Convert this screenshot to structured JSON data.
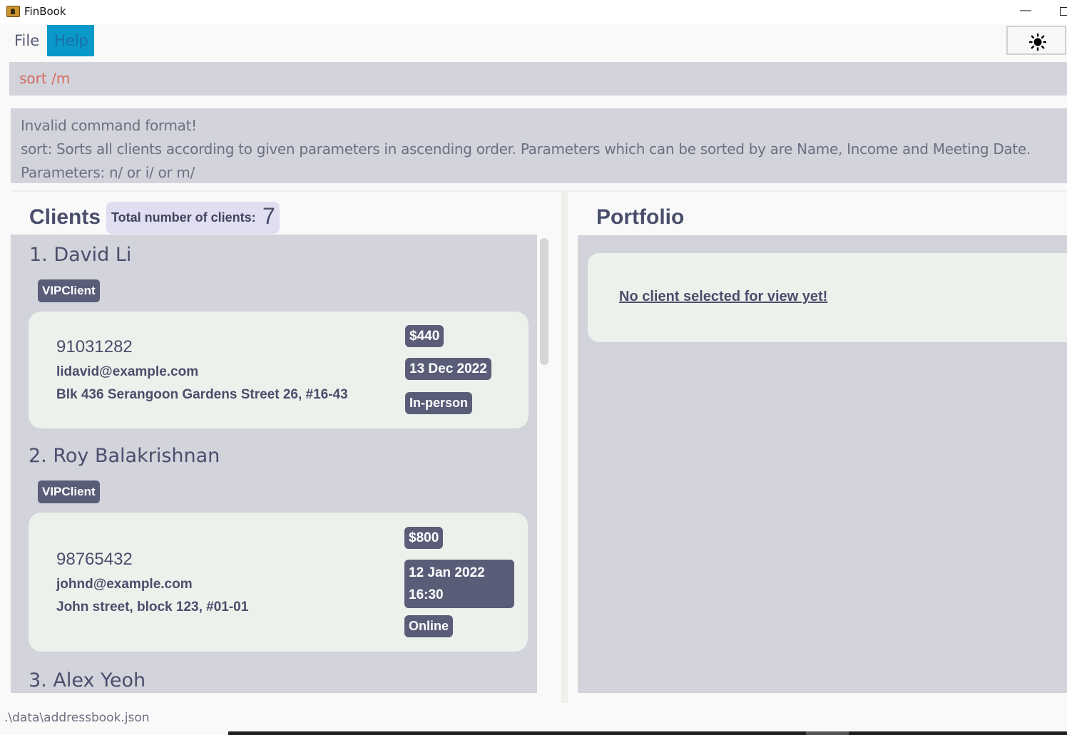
{
  "window": {
    "title": "FinBook"
  },
  "menu": {
    "file": "File",
    "help": "Help"
  },
  "command": {
    "value": "sort /m"
  },
  "result": {
    "lines": [
      "Invalid command format!",
      "sort: Sorts all clients according to given parameters in ascending order. Parameters which can be sorted by are Name, Income and Meeting Date.",
      "Parameters: n/ or i/ or m/"
    ]
  },
  "clients_panel": {
    "title": "Clients",
    "total_label": "Total number of clients:",
    "total_count": "7",
    "clients": [
      {
        "name": "1.  David Li",
        "tag": "VIPClient",
        "phone": "91031282",
        "email": "lidavid@example.com",
        "address": "Blk 436 Serangoon Gardens Street 26, #16-43",
        "income": "$440",
        "meeting_date": "13 Dec 2022",
        "meeting_mode": "In-person"
      },
      {
        "name": "2.  Roy Balakrishnan",
        "tag": "VIPClient",
        "phone": "98765432",
        "email": "johnd@example.com",
        "address": "John street, block 123, #01-01",
        "income": "$800",
        "meeting_date_line1": "12 Jan 2022",
        "meeting_date_line2": "16:30",
        "meeting_mode": "Online"
      },
      {
        "name": "3.  Alex Yeoh"
      }
    ]
  },
  "portfolio_panel": {
    "title": "Portfolio",
    "empty_message": "No client selected for view yet!"
  },
  "status": {
    "file_path": ".\\data\\addressbook.json"
  },
  "colors": {
    "accent": "#0999c9",
    "panel_bg": "#d3d3dc",
    "card_bg": "#edf1ec",
    "tag_bg": "#5a5d78",
    "text": "#4a4e6b",
    "command_text": "#d46b5a"
  },
  "icons": {
    "theme_toggle": "sun-icon"
  }
}
